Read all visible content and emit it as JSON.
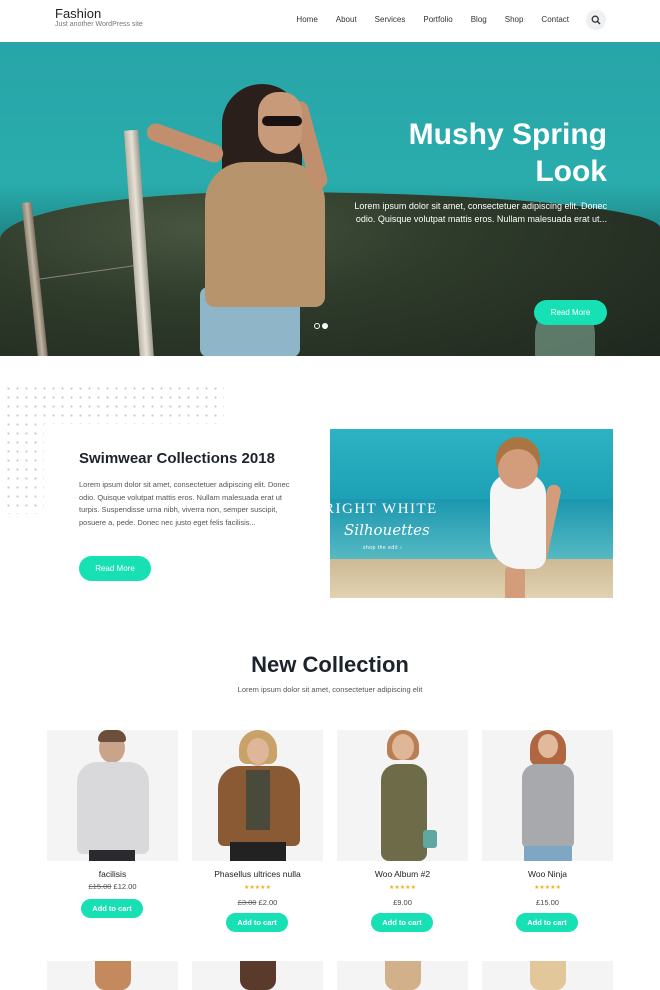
{
  "header": {
    "site_title": "Fashion",
    "tagline": "Just another WordPress site",
    "nav": [
      "Home",
      "About",
      "Services",
      "Portfolio",
      "Blog",
      "Shop",
      "Contact"
    ]
  },
  "hero": {
    "title_line1": "Mushy Spring",
    "title_line2": "Look",
    "text": "Lorem ipsum dolor sit amet, consectetuer adipiscing elit. Donec odio. Quisque volutpat mattis eros. Nullam malesuada erat ut...",
    "button": "Read More",
    "slides": 2,
    "active_slide": 2
  },
  "feature": {
    "title": "Swimwear Collections 2018",
    "text": "Lorem ipsum dolor sit amet, consectetuer adipiscing elit. Donec odio. Quisque volutpat mattis eros. Nullam malesuada erat ut turpis. Suspendisse urna nibh, viverra non, semper suscipit, posuere a, pede. Donec nec justo eget felis facilisis...",
    "button": "Read More",
    "image_text": {
      "headline": "RIGHT WHITE",
      "script": "Silhouettes",
      "sub": "shop the edit ›"
    }
  },
  "collection": {
    "title": "New Collection",
    "subtitle": "Lorem ipsum dolor sit amet, consectetuer adipiscing elit",
    "products": [
      {
        "name": "facilisis",
        "old_price": "£15.00",
        "price": "£12.00",
        "stars": "",
        "button": "Add to cart"
      },
      {
        "name": "Phasellus ultrices nulla",
        "old_price": "£3.00",
        "price": "£2.00",
        "stars": "★★★★★",
        "button": "Add to cart"
      },
      {
        "name": "Woo Album #2",
        "old_price": "",
        "price": "£9.00",
        "stars": "★★★★★",
        "button": "Add to cart"
      },
      {
        "name": "Woo Ninja",
        "old_price": "",
        "price": "£15.00",
        "stars": "★★★★★",
        "button": "Add to cart"
      }
    ]
  },
  "colors": {
    "accent": "#17e0b4",
    "heading": "#1d232b",
    "star": "#f2b01e"
  }
}
